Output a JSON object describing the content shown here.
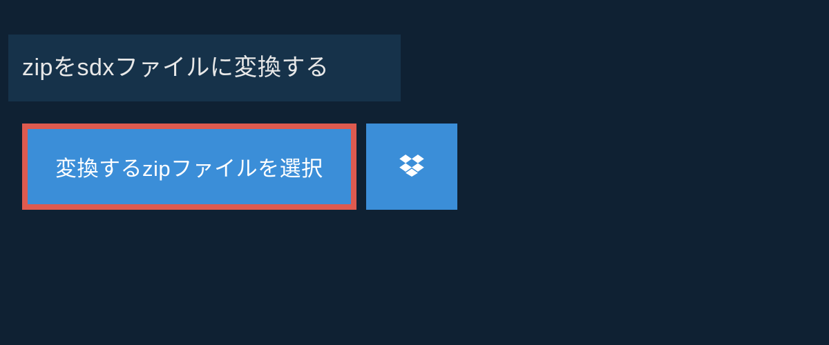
{
  "header": {
    "title": "zipをsdxファイルに変換する"
  },
  "actions": {
    "select_file_label": "変換するzipファイルを選択",
    "dropbox_icon_name": "dropbox"
  },
  "colors": {
    "background": "#0f2133",
    "panel": "#16324a",
    "button_primary": "#3b8ed8",
    "button_highlight_border": "#de5a4f",
    "text_light": "#e8e8e8",
    "text_white": "#ffffff"
  }
}
